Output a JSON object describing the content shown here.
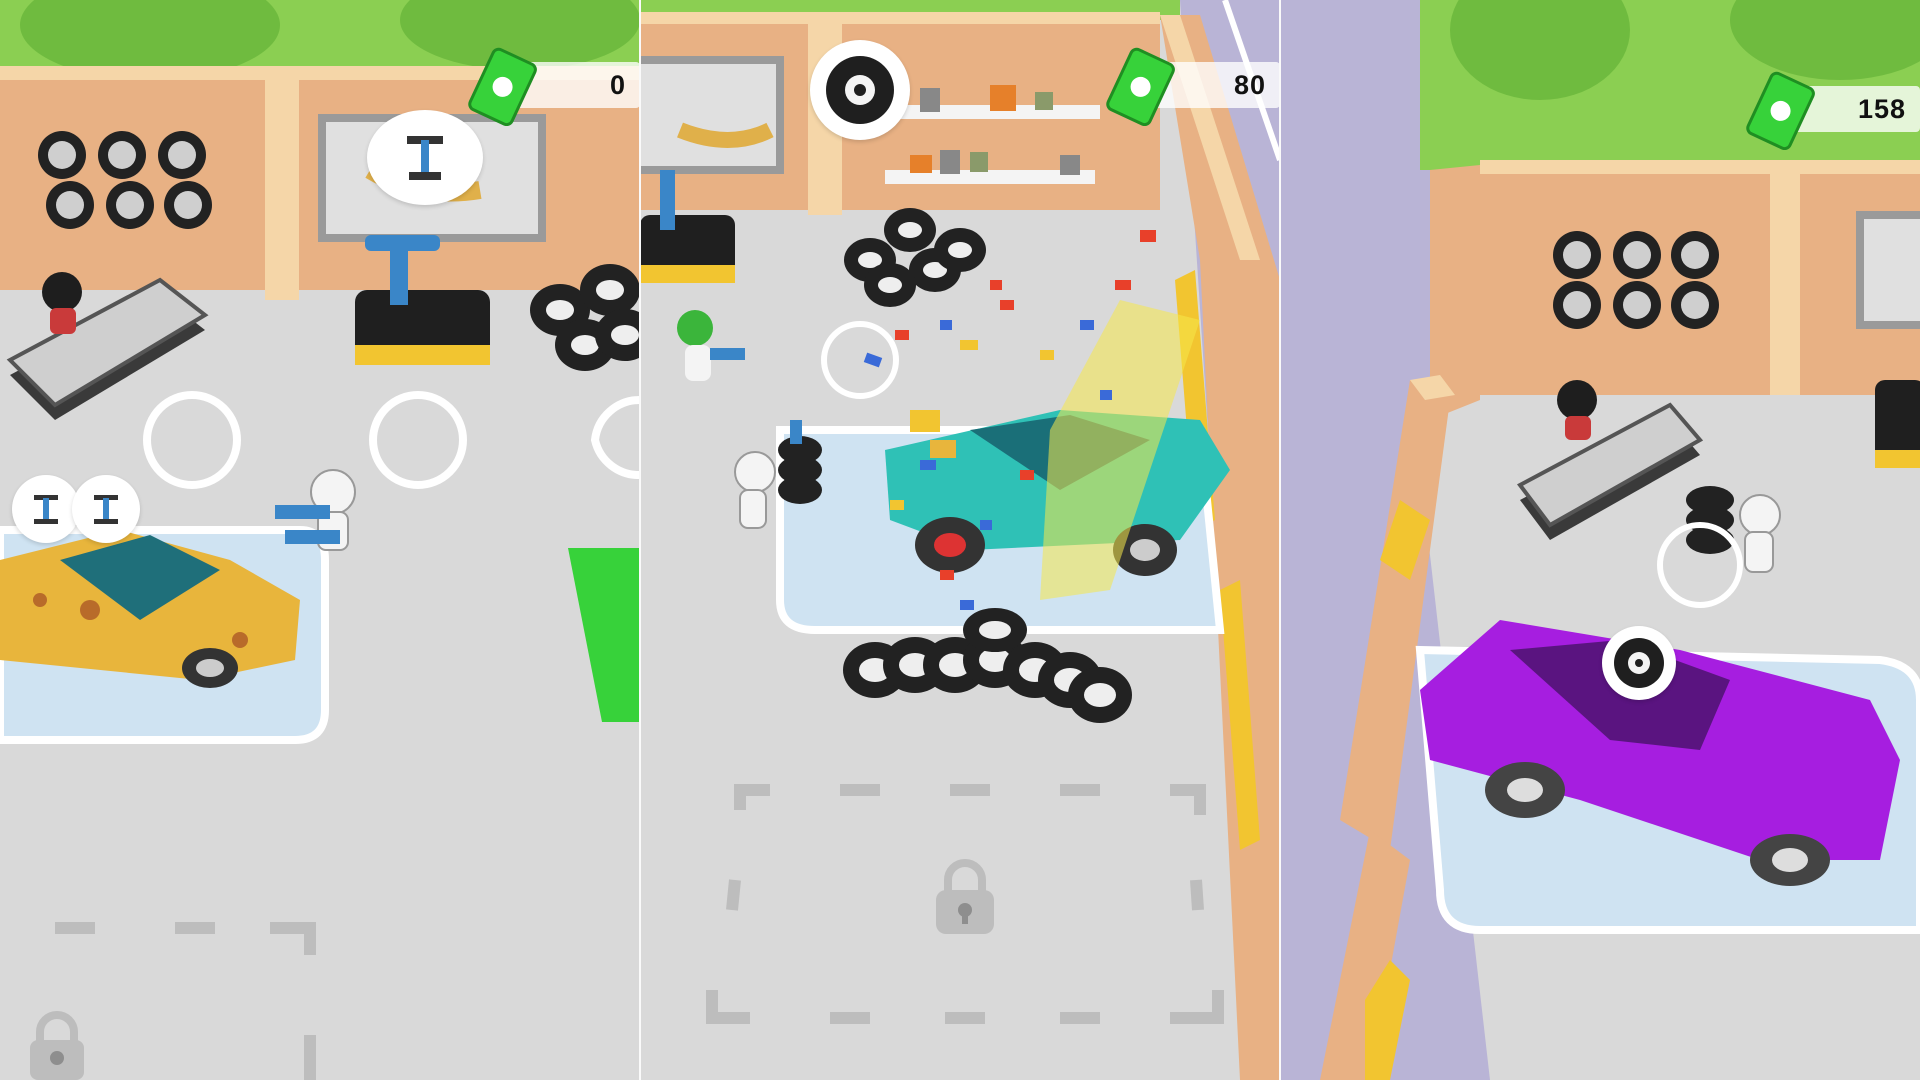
{
  "panels": [
    {
      "id": "left",
      "cash": "0",
      "has_lock": true,
      "icons": [
        "lift-jack-icon",
        "tire-stack-icon",
        "padlock-icon",
        "cash-icon"
      ]
    },
    {
      "id": "center",
      "cash": "80",
      "has_lock": true,
      "icons": [
        "tire-icon",
        "padlock-icon",
        "cash-icon"
      ]
    },
    {
      "id": "right",
      "cash": "158",
      "has_lock": false,
      "icons": [
        "tire-icon",
        "cash-icon"
      ]
    }
  ],
  "colors": {
    "floor": "#d9d9d9",
    "wall": "#e8b184",
    "wall_top": "#f5d6a8",
    "grass": "#8bcf52",
    "road": "#b9b4d6",
    "cash": "#37d23a",
    "car_yellow": "#e8b53c",
    "car_teal": "#2fc1b6",
    "car_purple": "#a61ee0",
    "jack_blue": "#3a86c8",
    "parking_blue": "#cfe3f2"
  }
}
